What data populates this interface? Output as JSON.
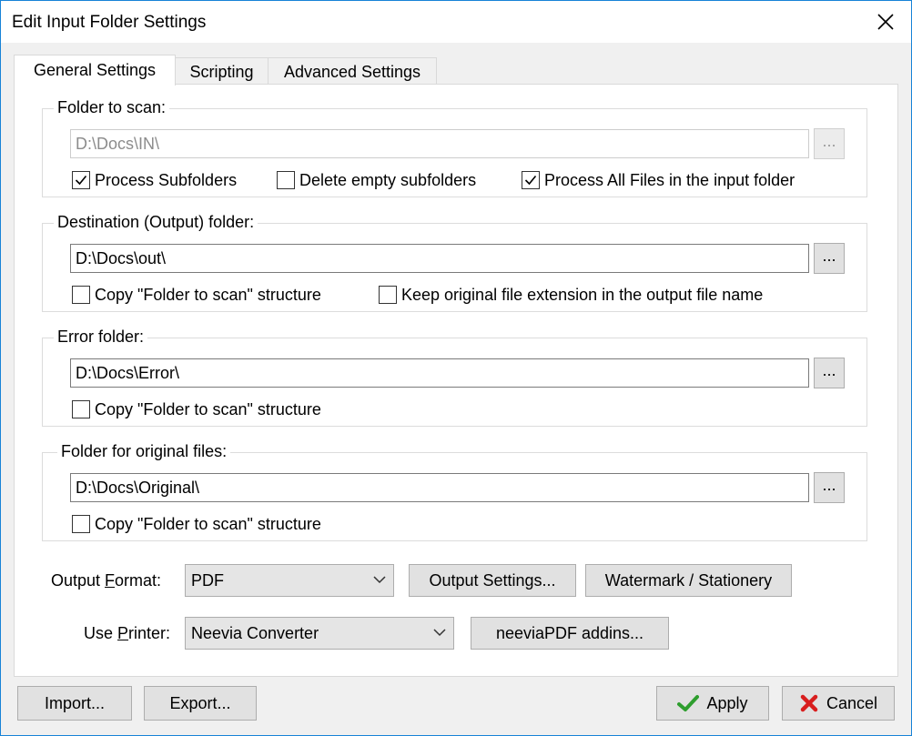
{
  "window": {
    "title": "Edit Input Folder Settings",
    "close_glyph": "✕"
  },
  "tabs": [
    {
      "label": "General Settings",
      "active": true
    },
    {
      "label": "Scripting",
      "active": false
    },
    {
      "label": "Advanced Settings",
      "active": false
    }
  ],
  "scan": {
    "legend": "Folder to scan:",
    "path": "D:\\Docs\\IN\\",
    "browse": "...",
    "process_subfolders": {
      "label": "Process Subfolders",
      "checked": true
    },
    "delete_empty": {
      "label": "Delete empty subfolders",
      "checked": false
    },
    "process_all": {
      "label": "Process All Files in the input folder",
      "checked": true
    }
  },
  "destination": {
    "legend": "Destination (Output) folder:",
    "path": "D:\\Docs\\out\\",
    "browse": "...",
    "copy_structure": {
      "label": "Copy \"Folder to scan\" structure",
      "checked": false
    },
    "keep_extension": {
      "label": "Keep original file extension in the output file name",
      "checked": false
    }
  },
  "error": {
    "legend": "Error folder:",
    "path": "D:\\Docs\\Error\\",
    "browse": "...",
    "copy_structure": {
      "label": "Copy \"Folder to scan\" structure",
      "checked": false
    }
  },
  "original": {
    "legend": "Folder for original files:",
    "path": "D:\\Docs\\Original\\",
    "browse": "...",
    "copy_structure": {
      "label": "Copy \"Folder to scan\" structure",
      "checked": false
    }
  },
  "output": {
    "format_label_pre": "Output ",
    "format_label_key": "F",
    "format_label_post": "ormat:",
    "format_value": "PDF",
    "settings_button": "Output Settings...",
    "watermark_button": "Watermark / Stationery"
  },
  "printer": {
    "label_pre": "Use ",
    "label_key": "P",
    "label_post": "rinter:",
    "value": "Neevia Converter",
    "addins_button": "neeviaPDF addins..."
  },
  "footer": {
    "import": "Import...",
    "export": "Export...",
    "apply": "Apply",
    "cancel": "Cancel"
  },
  "colors": {
    "accent_border": "#1883d7",
    "apply_check": "#2e9e2e",
    "cancel_x": "#d81e1e"
  }
}
